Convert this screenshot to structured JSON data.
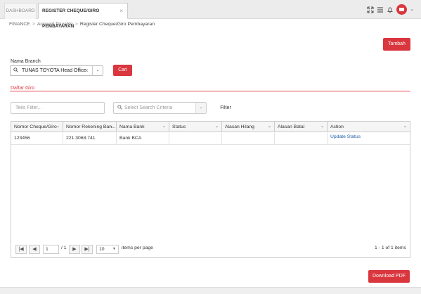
{
  "tabs": {
    "dashboard": "DASHBOARD",
    "active": "REGISTER CHEQUE/GIRO PEMBAYARAN",
    "close": "×"
  },
  "topbar": {
    "icons": [
      "expand-icon",
      "menu-icon",
      "bell-icon",
      "avatar",
      "chevron-down-icon"
    ]
  },
  "breadcrumb": {
    "items": [
      "FINANCE",
      "Account Payable",
      "Register Cheque/Giro Pembayaran"
    ],
    "separator": ">"
  },
  "actions": {
    "tambah": "Tambah",
    "cari": "Cari",
    "filter": "Filter",
    "download_pdf": "Download PDF"
  },
  "branch": {
    "label": "Nama Branch",
    "value": "TUNAS TOYOTA Head Office"
  },
  "section": {
    "title": "Daftar Giro"
  },
  "filters": {
    "text_placeholder": "Teks Filter...",
    "criteria_placeholder": "Select Search Criteria"
  },
  "table": {
    "columns": [
      "Nomor Cheque/Giro",
      "Nomor Rekening Ban...",
      "Nama Bank",
      "Status",
      "Alasan Hilang",
      "Alasan Batal",
      "Action"
    ],
    "rows": [
      [
        "123456",
        "221.3068.741",
        "Bank BCA",
        "",
        "",
        "",
        "Update Status"
      ]
    ]
  },
  "pager": {
    "first": "|◀",
    "prev": "◀",
    "page": "1",
    "of": "/ 1",
    "next": "▶",
    "last": "▶|",
    "per_page": "10",
    "per_page_label": "items per page",
    "summary": "1 - 1 of 1 items"
  },
  "colors": {
    "accent": "#d9363e",
    "link": "#1e5aa8"
  }
}
